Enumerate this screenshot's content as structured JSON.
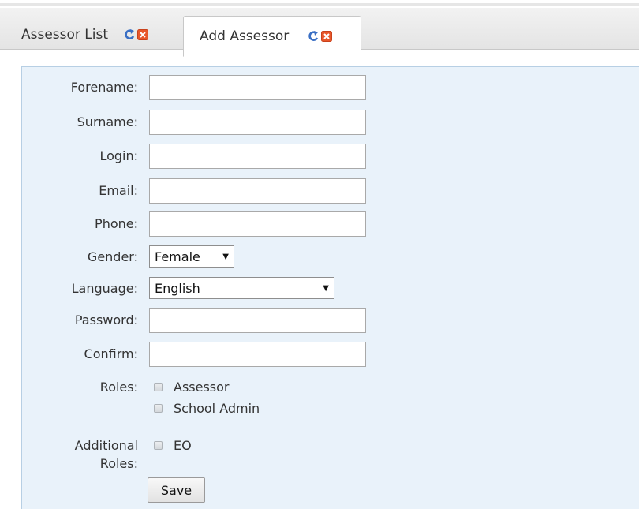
{
  "tabs": [
    {
      "label": "Assessor List",
      "active": false
    },
    {
      "label": "Add Assessor",
      "active": true
    }
  ],
  "form": {
    "forename": {
      "label": "Forename:",
      "value": ""
    },
    "surname": {
      "label": "Surname:",
      "value": ""
    },
    "login": {
      "label": "Login:",
      "value": ""
    },
    "email": {
      "label": "Email:",
      "value": ""
    },
    "phone": {
      "label": "Phone:",
      "value": ""
    },
    "gender": {
      "label": "Gender:",
      "selected": "Female"
    },
    "language": {
      "label": "Language:",
      "selected": "English"
    },
    "password": {
      "label": "Password:",
      "value": ""
    },
    "confirm": {
      "label": "Confirm:",
      "value": ""
    },
    "roles": {
      "label": "Roles:",
      "options": [
        {
          "label": "Assessor",
          "checked": false
        },
        {
          "label": "School Admin",
          "checked": false
        }
      ]
    },
    "additional_roles": {
      "label_line1": "Additional",
      "label_line2": "Roles:",
      "options": [
        {
          "label": "EO",
          "checked": false
        }
      ]
    },
    "save_label": "Save"
  },
  "icons": {
    "refresh": "refresh-icon",
    "close": "close-icon"
  },
  "colors": {
    "panel_bg": "#e9f2fa",
    "panel_border": "#b7cfe4",
    "refresh_blue": "#3a6fc4",
    "close_orange": "#e8572b"
  }
}
